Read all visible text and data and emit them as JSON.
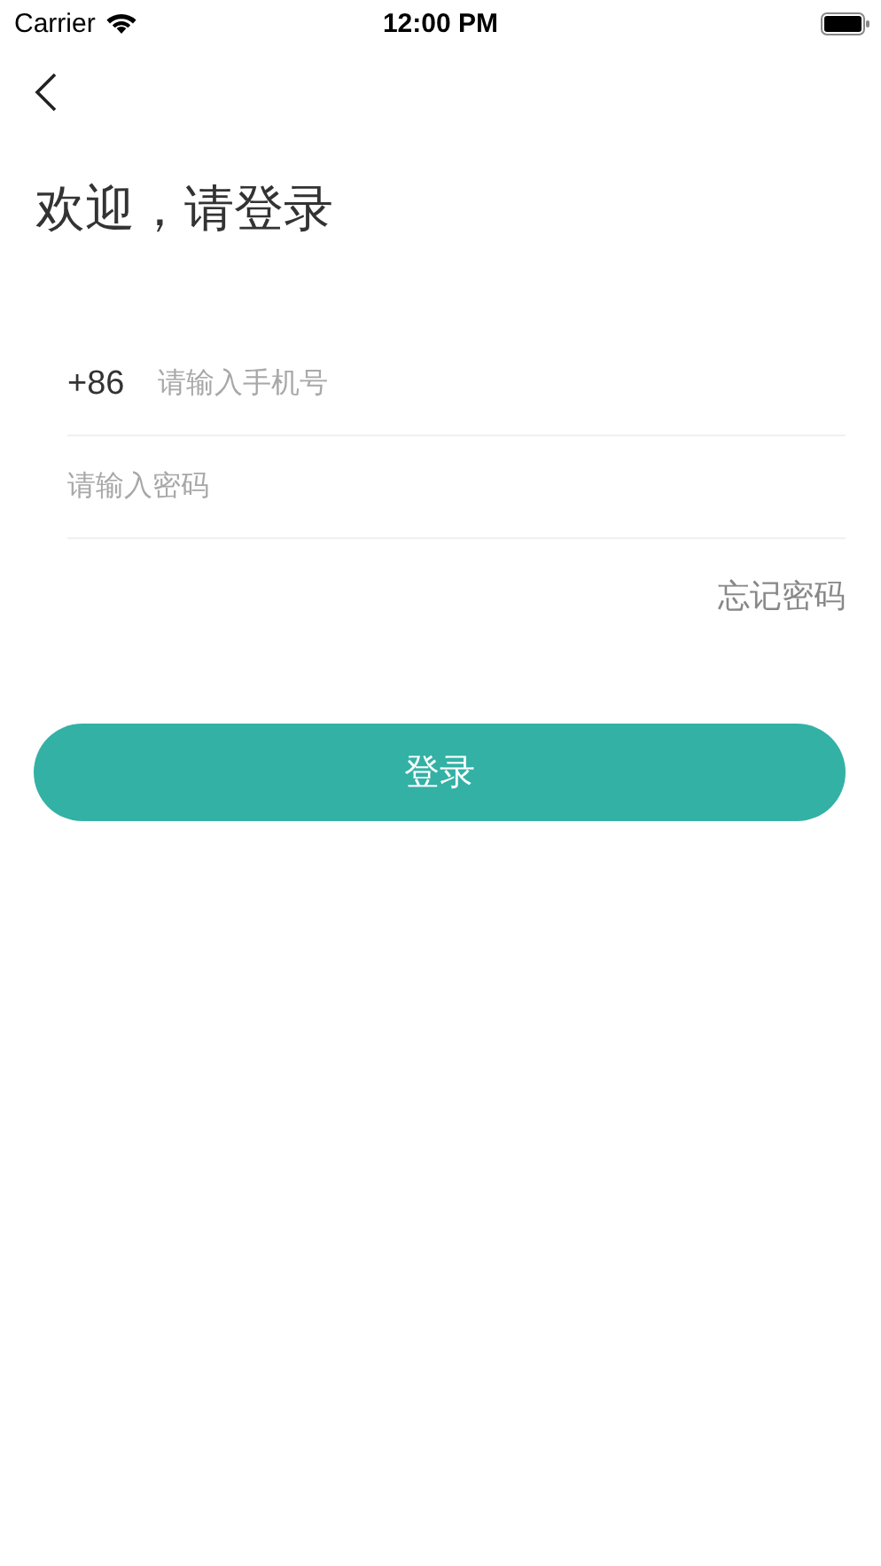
{
  "status_bar": {
    "carrier": "Carrier",
    "time": "12:00 PM"
  },
  "title": "欢迎，请登录",
  "phone_field": {
    "prefix": "+86",
    "placeholder": "请输入手机号"
  },
  "password_field": {
    "placeholder": "请输入密码"
  },
  "forgot_link": "忘记密码",
  "login_button": "登录"
}
